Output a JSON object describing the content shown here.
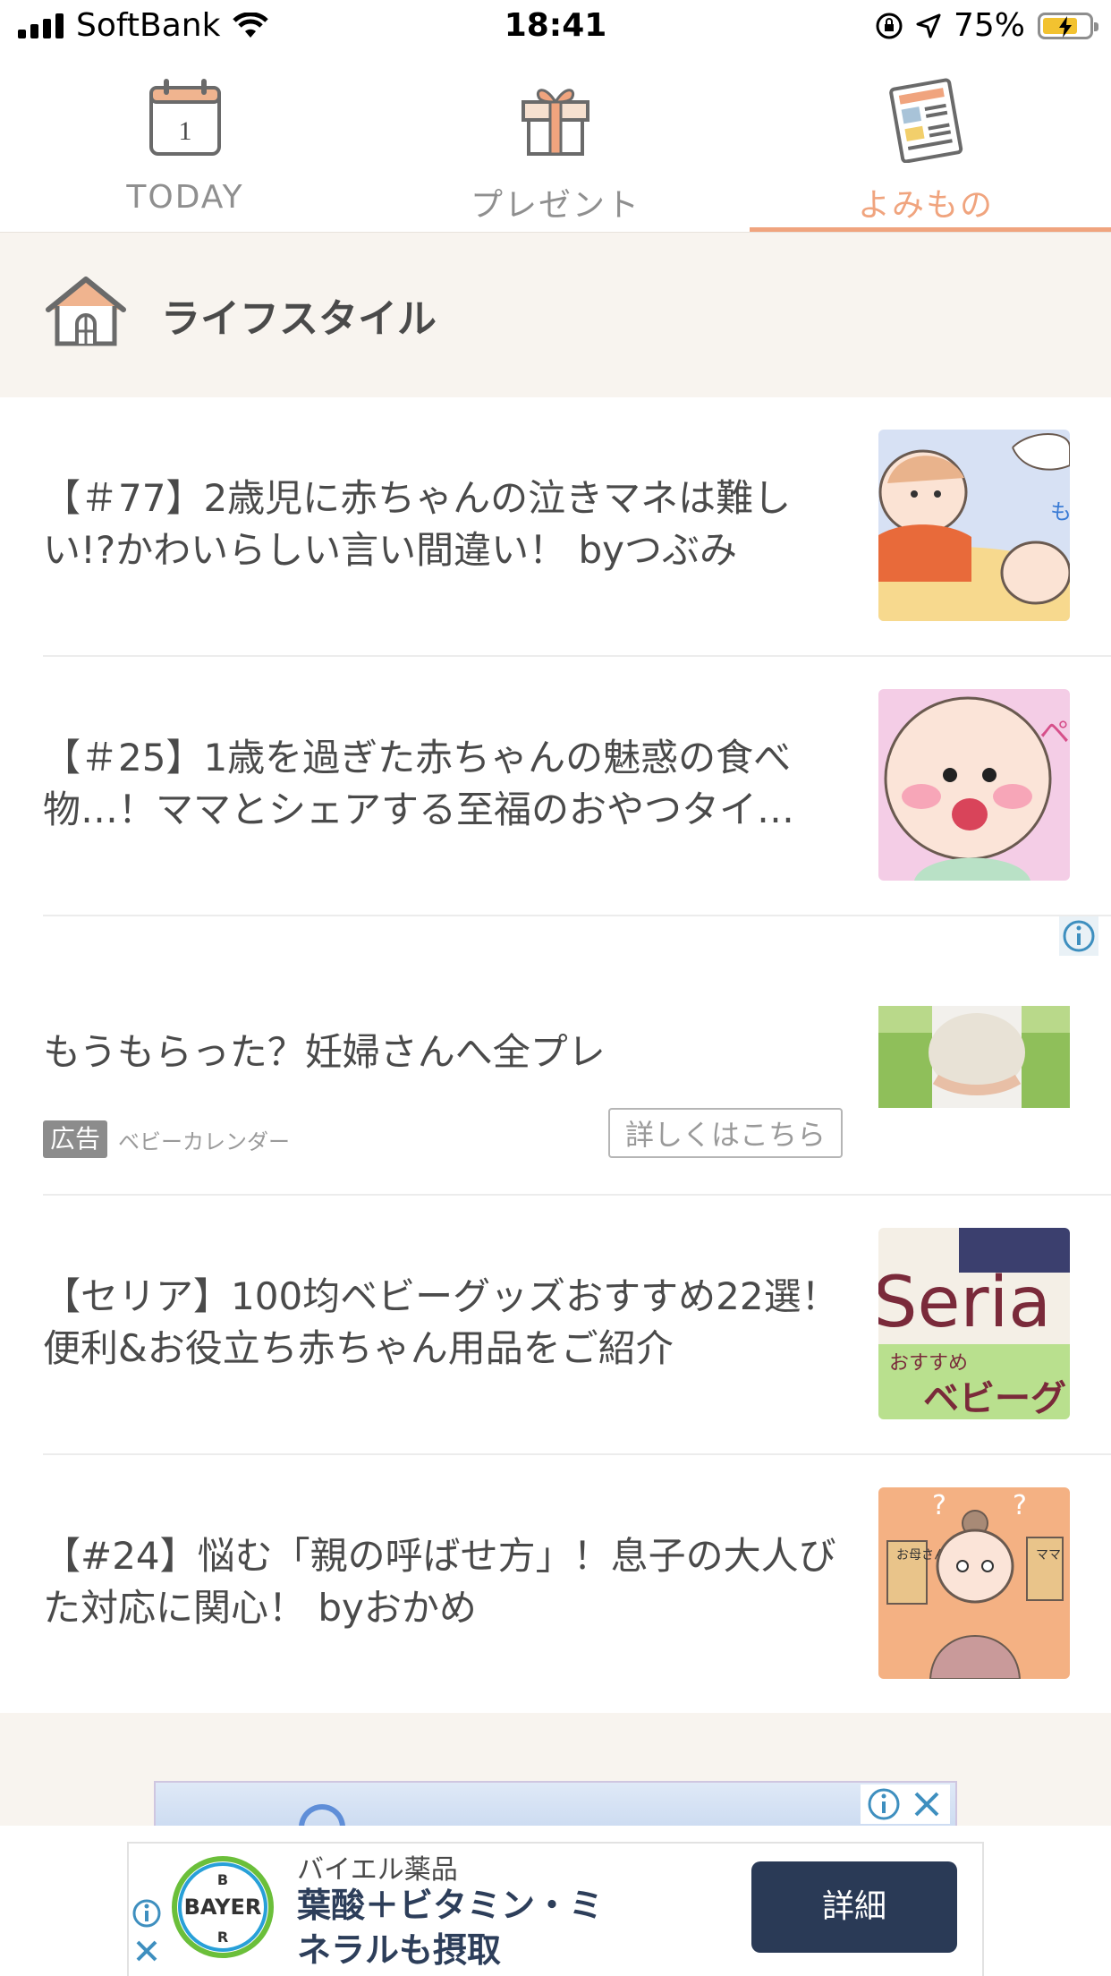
{
  "status_bar": {
    "carrier": "SoftBank",
    "time": "18:41",
    "battery": "75%",
    "battery_level": 0.75
  },
  "tabs": [
    {
      "label": "TODAY",
      "icon": "calendar-icon",
      "calendar_day": "1",
      "active": false
    },
    {
      "label": "プレゼント",
      "icon": "gift-icon",
      "active": false
    },
    {
      "label": "よみもの",
      "icon": "newspaper-icon",
      "active": true
    }
  ],
  "section": {
    "title": "ライフスタイル",
    "icon": "house-icon"
  },
  "articles": [
    {
      "title": "【＃77】2歳児に赤ちゃんの泣きマネは難しい!?かわいらしい言い間違い！ byつぶみ",
      "thumbnail": "comic-toddler-baby"
    },
    {
      "title": "【＃25】1歳を過ぎた赤ちゃんの魅惑の食べ物…！ママとシェアする至福のおやつタイ…",
      "thumbnail": "comic-baby-face"
    },
    {
      "title": "【セリア】100均ベビーグッズおすすめ22選！便利&お役立ち赤ちゃん用品をご紹介",
      "thumbnail": "seria-banner",
      "thumb_text": {
        "line1": "Seria",
        "line2": "おすすめ",
        "line3": "ベビーグ"
      }
    },
    {
      "title": "【#24】悩む「親の呼ばせ方」！息子の大人びた対応に関心！ byおかめ",
      "thumbnail": "comic-mother-signs",
      "thumb_text": {
        "sign1": "お母さん",
        "sign2": "ママ"
      }
    }
  ],
  "ad_article": {
    "title": "もうもらった？妊婦さんへ全プレ",
    "badge": "広告",
    "sponsor": "ベビーカレンダー",
    "button_label": "詳しくはこちら",
    "info_icon": "info-icon"
  },
  "bottom_ad": {
    "company": "バイエル薬品",
    "headline": "葉酸＋ビタミン・ミネラルも摂取",
    "cta_label": "詳細",
    "logo_text": "BAYER"
  },
  "colors": {
    "accent": "#f0a47e",
    "section_bg": "#f8f4ef",
    "cta_bg": "#2a3a56"
  }
}
